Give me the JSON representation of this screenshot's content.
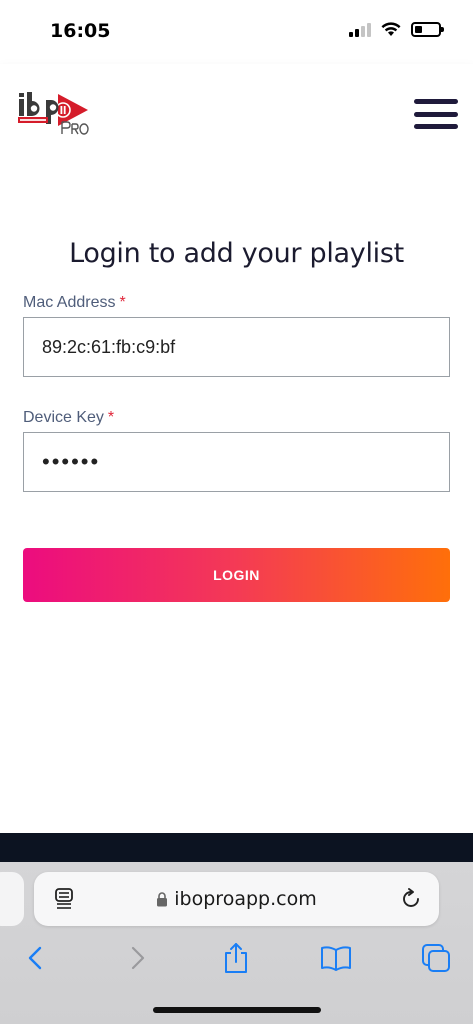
{
  "status_bar": {
    "time": "16:05",
    "battery_level": 0.3
  },
  "header": {
    "logo_text": "ibo PLAYER PRO",
    "menu_icon": "hamburger-icon"
  },
  "form": {
    "title": "Login to add your playlist",
    "mac_label": "Mac Address",
    "mac_value": "89:2c:61:fb:c9:bf",
    "device_key_label": "Device Key",
    "device_key_value": "••••••",
    "required_mark": "*",
    "login_label": "LOGIN"
  },
  "browser": {
    "url": "iboproapp.com",
    "icons": [
      "reader-icon",
      "lock-icon",
      "reload-icon",
      "back-icon",
      "forward-icon",
      "share-icon",
      "bookmarks-icon",
      "tabs-icon"
    ]
  },
  "colors": {
    "accent_gradient_start": "#ec0c7f",
    "accent_gradient_end": "#ff6f0a",
    "title": "#1b1b2f",
    "label": "#4f5d7a",
    "required": "#e0263a",
    "ios_blue": "#1a7ef5"
  }
}
